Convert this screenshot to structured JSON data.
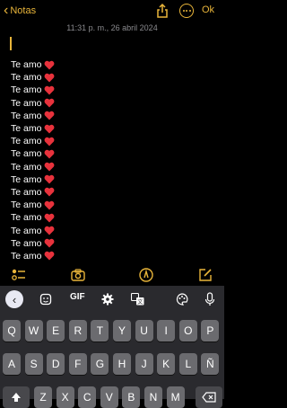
{
  "topbar": {
    "back_label": "Notas",
    "done_label": "Ok"
  },
  "note": {
    "date": "11:31 p. m., 26 abril 2024",
    "lines": [
      "Te amo",
      "Te amo",
      "Te amo",
      "Te amo",
      "Te amo",
      "Te amo",
      "Te amo",
      "Te amo",
      "Te amo",
      "Te amo",
      "Te amo",
      "Te amo",
      "Te amo",
      "Te amo",
      "Te amo",
      "Te amo"
    ]
  },
  "toolbar": {
    "icons": [
      "checklist-icon",
      "camera-icon",
      "markup-icon",
      "compose-icon"
    ]
  },
  "keyboard": {
    "suggestion_bar": {
      "gif_label": "GIF",
      "icons": [
        "back-icon",
        "sticker-icon",
        "settings-icon",
        "translate-icon",
        "palette-icon",
        "mic-icon"
      ]
    },
    "row1": [
      "Q",
      "W",
      "E",
      "R",
      "T",
      "Y",
      "U",
      "I",
      "O",
      "P"
    ],
    "row2": [
      "A",
      "S",
      "D",
      "F",
      "G",
      "H",
      "J",
      "K",
      "L",
      "Ñ"
    ],
    "row3": [
      "Z",
      "X",
      "C",
      "V",
      "B",
      "N",
      "M"
    ]
  },
  "colors": {
    "accent": "#e9b53a",
    "heart": "#e8323c",
    "background": "#000000",
    "keyboard": "#2a2a2e",
    "key": "#6b6b6f"
  }
}
